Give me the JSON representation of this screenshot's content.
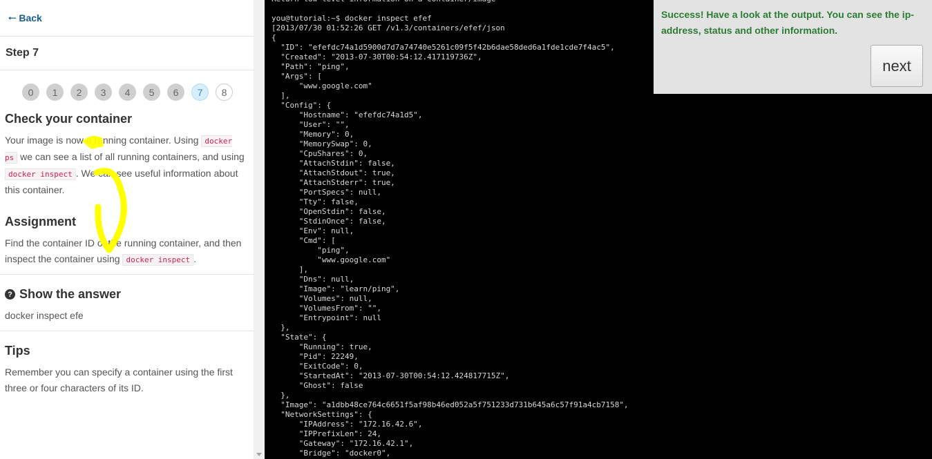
{
  "sidebar": {
    "back_label": "Back",
    "step_title": "Step 7",
    "steps": [
      "0",
      "1",
      "2",
      "3",
      "4",
      "5",
      "6",
      "7",
      "8"
    ],
    "current_step": "7",
    "check": {
      "title": "Check your container",
      "p1": "Your image is now a running container. Using ",
      "code1": "docker ps",
      "p2": " we can see a list of all running containers, and using ",
      "code2": "docker inspect",
      "p3": ". We can see useful information about this container."
    },
    "assignment": {
      "title": "Assignment",
      "p1": "Find the container ID of the running container, and then inspect the container using ",
      "code1": "docker inspect",
      "p2": "."
    },
    "answer": {
      "title": "Show the answer",
      "text": "docker inspect efe"
    },
    "tips": {
      "title": "Tips",
      "text": "Remember you can specify a container using the first three or four characters of its ID."
    }
  },
  "terminal": {
    "output": "Return low-level information on a container/image\n\nyou@tutorial:~$ docker inspect efef\n[2013/07/30 01:52:26 GET /v1.3/containers/efef/json\n{\n  \"ID\": \"efefdc74a1d5900d7d7a74740e5261c09f5f42b6dae58ded6a1fde1cde7f4ac5\",\n  \"Created\": \"2013-07-30T00:54:12.417119736Z\",\n  \"Path\": \"ping\",\n  \"Args\": [\n      \"www.google.com\"\n  ],\n  \"Config\": {\n      \"Hostname\": \"efefdc74a1d5\",\n      \"User\": \"\",\n      \"Memory\": 0,\n      \"MemorySwap\": 0,\n      \"CpuShares\": 0,\n      \"AttachStdin\": false,\n      \"AttachStdout\": true,\n      \"AttachStderr\": true,\n      \"PortSpecs\": null,\n      \"Tty\": false,\n      \"OpenStdin\": false,\n      \"StdinOnce\": false,\n      \"Env\": null,\n      \"Cmd\": [\n          \"ping\",\n          \"www.google.com\"\n      ],\n      \"Dns\": null,\n      \"Image\": \"learn/ping\",\n      \"Volumes\": null,\n      \"VolumesFrom\": \"\",\n      \"Entrypoint\": null\n  },\n  \"State\": {\n      \"Running\": true,\n      \"Pid\": 22249,\n      \"ExitCode\": 0,\n      \"StartedAt\": \"2013-07-30T00:54:12.424817715Z\",\n      \"Ghost\": false\n  },\n  \"Image\": \"a1dbb48ce764c6651f5af98b46ed052a5f751233d731b645a6c57f91a4cb7158\",\n  \"NetworkSettings\": {\n      \"IPAddress\": \"172.16.42.6\",\n      \"IPPrefixLen\": 24,\n      \"Gateway\": \"172.16.42.1\",\n      \"Bridge\": \"docker0\","
  },
  "success": {
    "message": "Success! Have a look at the output. You can see the ip-address, status and other information.",
    "next_label": "next"
  },
  "colors": {
    "link": "#1a5f8a",
    "success_text": "#2a7d33",
    "current_step_bg": "#d9eefb",
    "highlight": "#ffff00"
  }
}
